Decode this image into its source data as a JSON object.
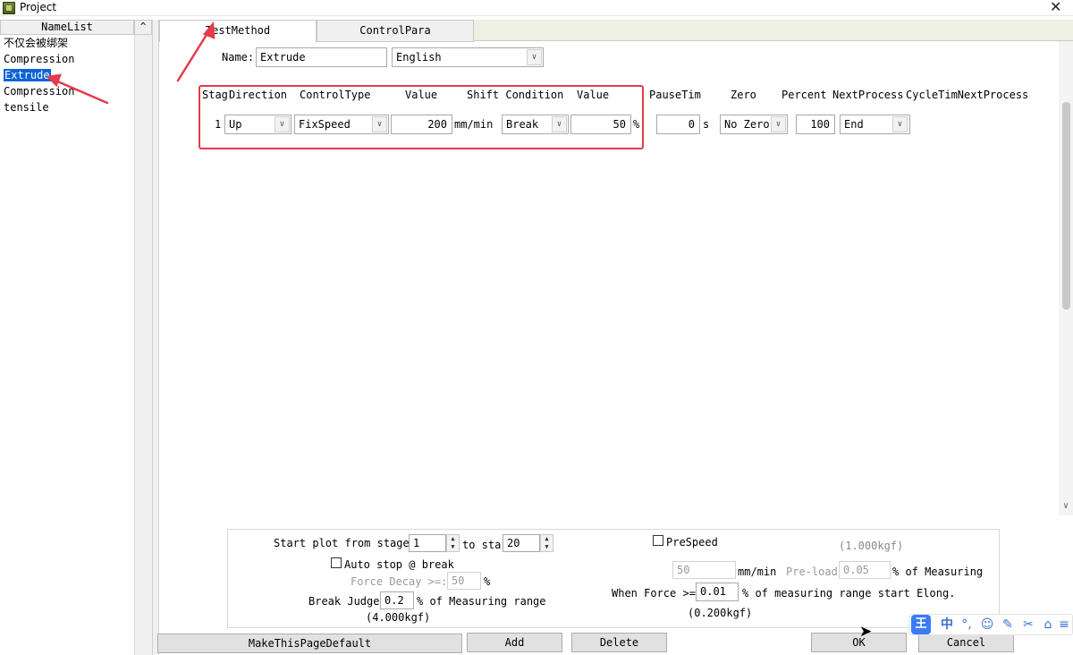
{
  "window": {
    "title": "Project"
  },
  "namelist": {
    "header": "NameList",
    "collapse_glyph": "^",
    "items": [
      {
        "label": "不仅会被绑架"
      },
      {
        "label": "Compression"
      },
      {
        "label": "Extrude",
        "selected": true
      },
      {
        "label": "Compression"
      },
      {
        "label": "tensile"
      }
    ]
  },
  "tabs": [
    {
      "label": "TestMethod",
      "active": true
    },
    {
      "label": "ControlPara",
      "active": false
    }
  ],
  "name_row": {
    "label": "Name:",
    "value": "Extrude",
    "language": "English"
  },
  "stage_headers": {
    "stag": "Stag",
    "direction": "Direction",
    "control_type": "ControlType",
    "value": "Value",
    "shift_condition": "Shift Condition",
    "value2": "Value",
    "pause_time": "PauseTim",
    "zero": "Zero",
    "percent": "Percent",
    "next_process": "NextProcess",
    "cycle_time_next_process": "CycleTimNextProcess"
  },
  "stage_row": {
    "index": "1",
    "direction": "Up",
    "control_type": "FixSpeed",
    "value": "200",
    "value_unit": "mm/min",
    "condition": "Break",
    "condition_value": "50",
    "condition_unit": "%",
    "pause": "0",
    "pause_unit": "s",
    "zero": "No Zero",
    "percent": "100",
    "next_process": "End"
  },
  "bottom": {
    "start_plot_label": "Start plot from stage",
    "start_stage": "1",
    "to_stage_label": "to sta",
    "end_stage": "20",
    "auto_stop_label": "Auto stop @ break",
    "force_decay_label": "Force Decay >=:",
    "force_decay_value": "50",
    "force_decay_unit": "%",
    "break_judge_label": "Break Judge",
    "break_judge_value": "0.2",
    "break_judge_suffix": "% of Measuring range",
    "break_judge_kgf": "(4.000kgf)",
    "prespeed_label": "PreSpeed",
    "prespeed_kgf": "(1.000kgf)",
    "prespeed_value": "50",
    "prespeed_unit": "mm/min",
    "preload_label": "Pre-load",
    "preload_value": "0.05",
    "preload_suffix": "% of Measuring",
    "when_force_label": "When Force >=",
    "when_force_value": "0.01",
    "when_force_suffix": "% of measuring range start Elong.",
    "when_force_kgf": "(0.200kgf)"
  },
  "buttons": {
    "make_default": "MakeThisPageDefault",
    "add": "Add",
    "delete": "Delete",
    "ok": "OK",
    "cancel": "Cancel"
  },
  "ime": {
    "logo": "王",
    "lang": "中",
    "punct": "°,",
    "emoji": "☺",
    "pen": "✎",
    "scissors": "✂",
    "skin": "⌂",
    "menu": "≡"
  },
  "annotation_color": "#e63a4d",
  "selection_color": "#0a64d8"
}
